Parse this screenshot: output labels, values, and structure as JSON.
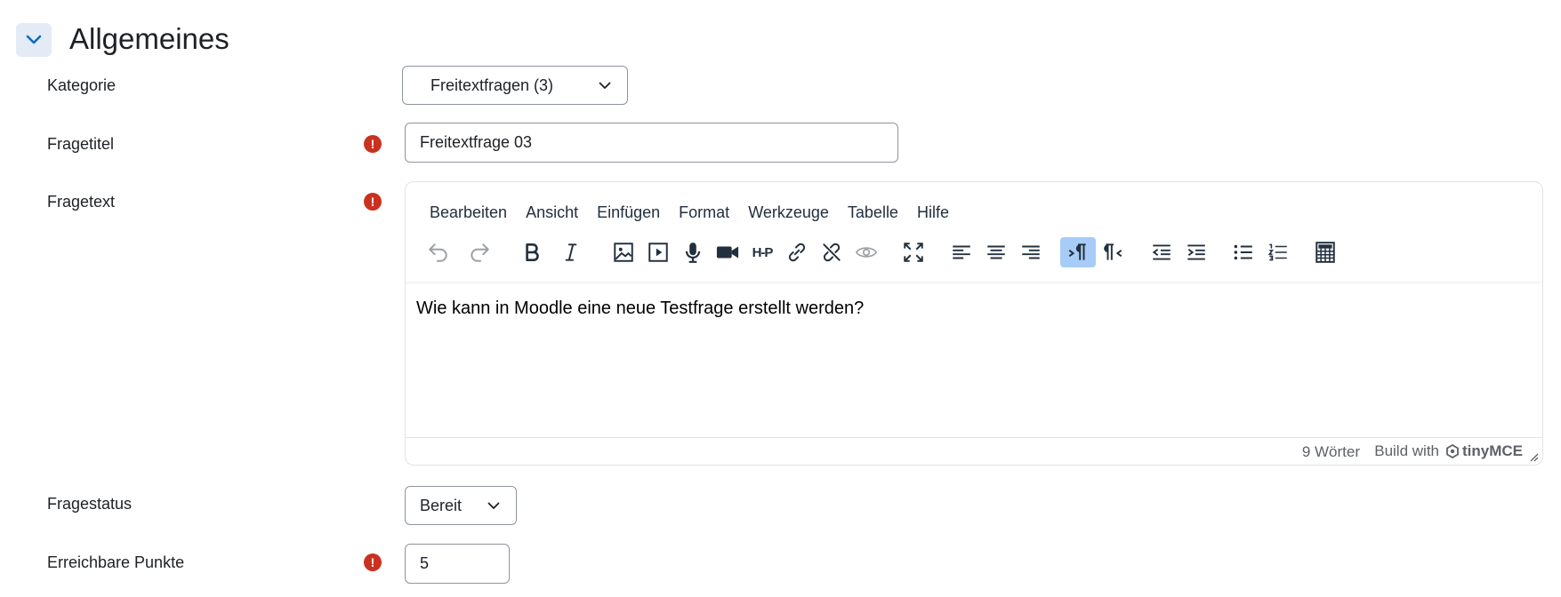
{
  "section": {
    "title": "Allgemeines"
  },
  "fields": {
    "category": {
      "label": "Kategorie",
      "value": "Freitextfragen (3)"
    },
    "title": {
      "label": "Fragetitel",
      "value": "Freitextfrage 03",
      "required": "!"
    },
    "text": {
      "label": "Fragetext",
      "required": "!"
    },
    "status": {
      "label": "Fragestatus",
      "value": "Bereit"
    },
    "points": {
      "label": "Erreichbare Punkte",
      "value": "5",
      "required": "!"
    }
  },
  "editor": {
    "menu": [
      "Bearbeiten",
      "Ansicht",
      "Einfügen",
      "Format",
      "Werkzeuge",
      "Tabelle",
      "Hilfe"
    ],
    "content": "Wie kann in Moodle eine neue Testfrage erstellt werden?",
    "word_count": "9 Wörter",
    "build_with": "Build with",
    "brand": "tinyMCE",
    "h5p_label": "H-P",
    "toolbar": [
      "undo-icon",
      "redo-icon",
      "bold-icon",
      "italic-icon",
      "image-icon",
      "media-icon",
      "microphone-icon",
      "video-camera-icon",
      "h5p-icon",
      "link-icon",
      "unlink-icon",
      "preview-icon",
      "fullscreen-icon",
      "align-left-icon",
      "align-center-icon",
      "align-right-icon",
      "ltr-icon",
      "rtl-icon",
      "outdent-icon",
      "indent-icon",
      "bullet-list-icon",
      "numbered-list-icon",
      "calculator-icon"
    ]
  },
  "colors": {
    "required": "#ca3120",
    "accent": "#0f6cbf",
    "active_tool": "#a6ccf7"
  }
}
